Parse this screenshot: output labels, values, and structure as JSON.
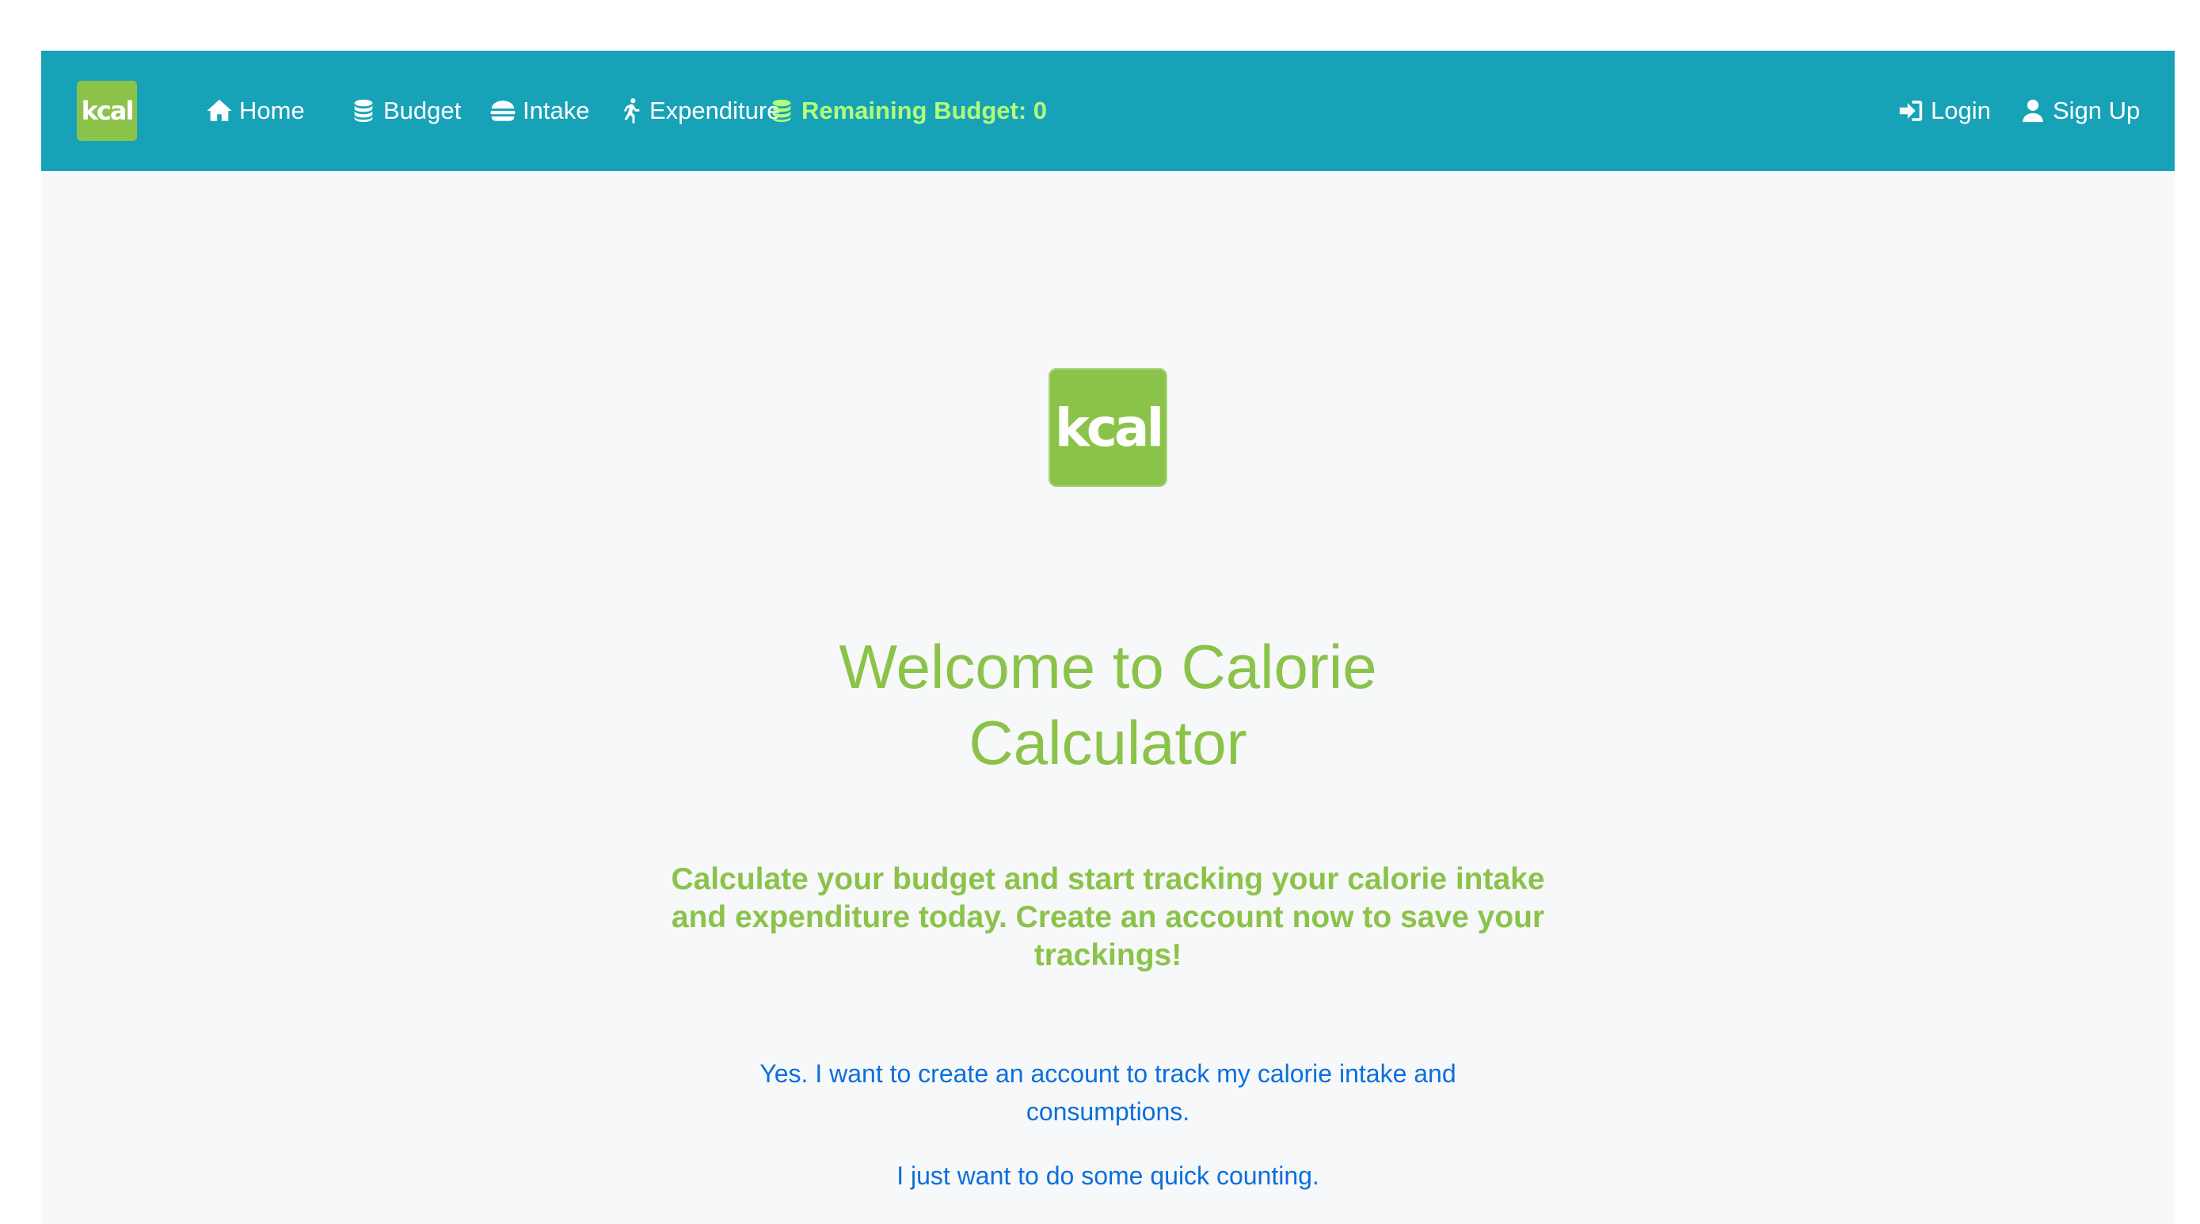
{
  "navbar": {
    "logo_text": "kcal",
    "items": [
      {
        "label": "Home",
        "icon": "home-icon"
      },
      {
        "label": "Budget",
        "icon": "coins-icon"
      },
      {
        "label": "Intake",
        "icon": "burger-icon"
      },
      {
        "label": "Expenditure",
        "icon": "running-icon"
      }
    ],
    "remaining_budget": {
      "label": "Remaining Budget: 0",
      "icon": "coins-icon"
    },
    "login_label": "Login",
    "signup_label": "Sign Up"
  },
  "hero": {
    "logo_text": "kcal",
    "title": "Welcome to Calorie Calculator",
    "subtitle": "Calculate your budget and start tracking your calorie intake and expenditure today. Create an account now to save your trackings!",
    "cta_account": "Yes. I want to create an account to track my calorie intake and consumptions.",
    "cta_quick": "I just want to do some quick counting."
  },
  "colors": {
    "navbar_bg": "#17a2b8",
    "brand_green": "#8bc34a",
    "highlight_green": "#b3ff7a",
    "link_blue": "#0a6fdc",
    "page_bg": "#f7f8f9"
  }
}
